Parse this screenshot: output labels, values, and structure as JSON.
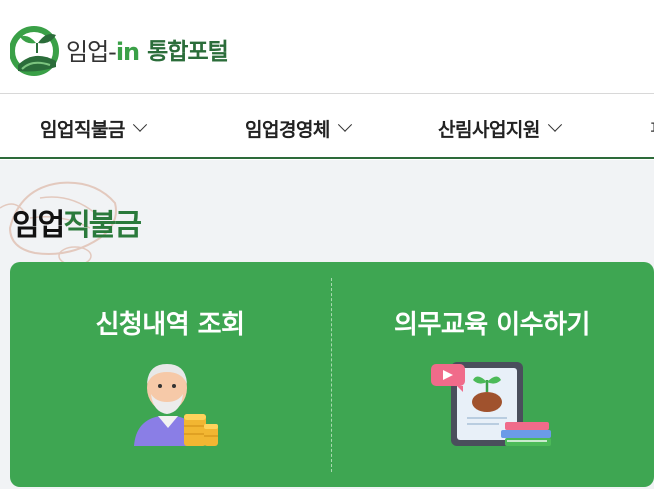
{
  "header": {
    "logo_main": "임업-",
    "logo_in": "in",
    "logo_sub": "통합포털"
  },
  "nav": {
    "items": [
      {
        "label": "임업직불금"
      },
      {
        "label": "임업경영체"
      },
      {
        "label": "산림사업지원"
      }
    ],
    "more": "ㅍ"
  },
  "hero": {
    "title_part1": "임업",
    "title_part2": "직불금"
  },
  "cards": [
    {
      "label": "신청내역 조회",
      "icon": "elderly-man-coins-icon"
    },
    {
      "label": "의무교육 이수하기",
      "icon": "tablet-video-education-icon"
    }
  ],
  "colors": {
    "brand_green": "#3aa047",
    "card_green": "#3ea652",
    "dark_green": "#2a7a3b",
    "background": "#f1f3f5"
  }
}
